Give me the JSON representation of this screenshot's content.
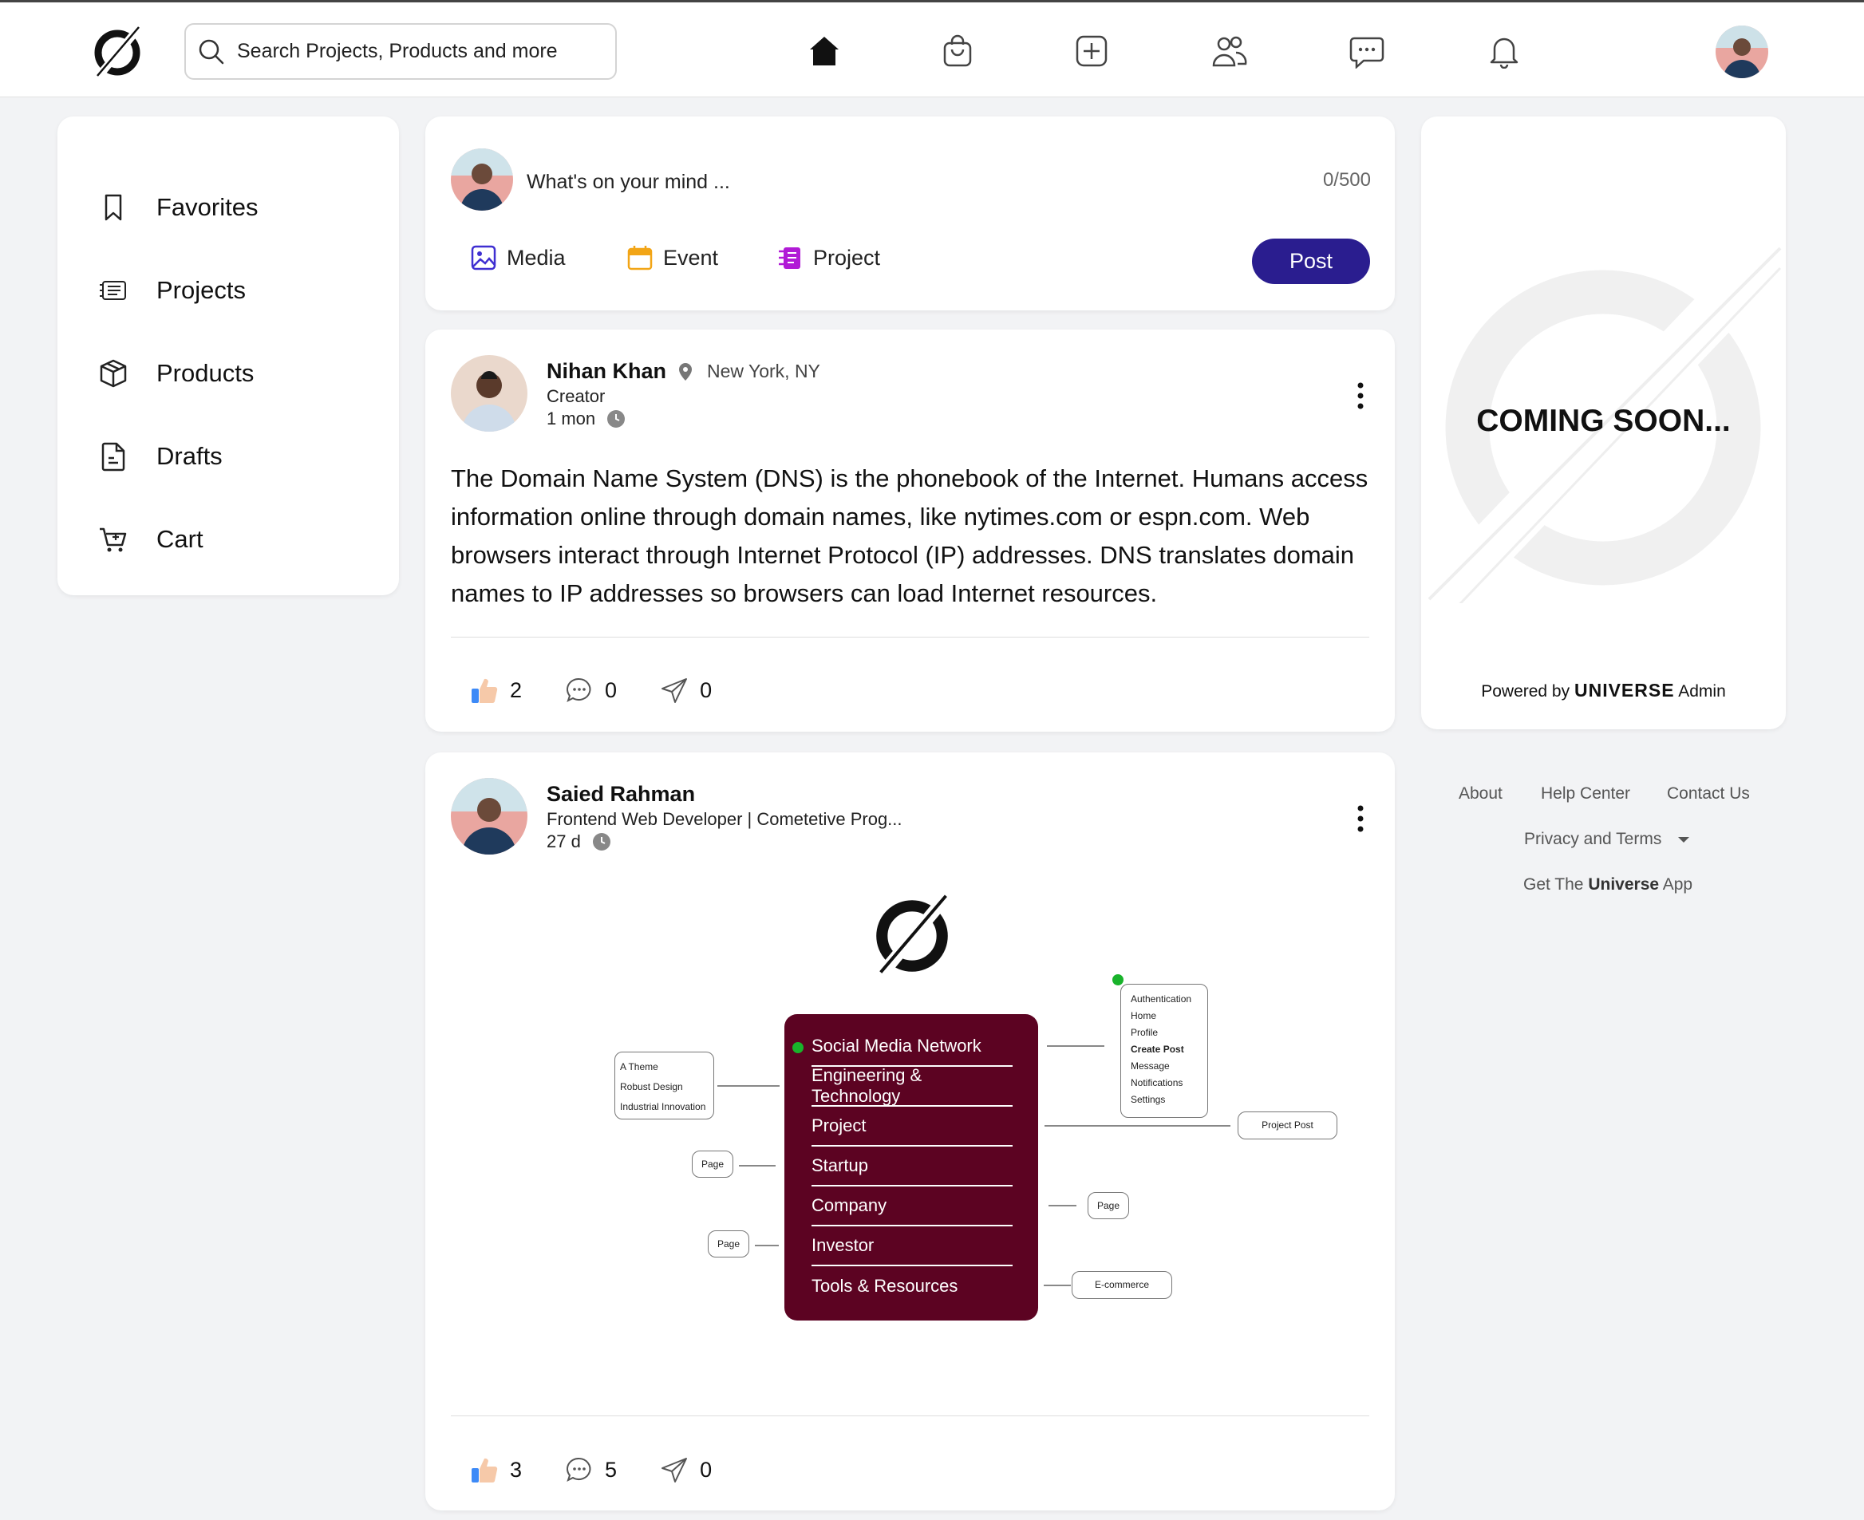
{
  "header": {
    "search_placeholder": "Search Projects, Products and more",
    "nav_icons": [
      "home-icon",
      "shopping-bag-icon",
      "plus-square-icon",
      "people-icon",
      "chat-icon",
      "bell-icon"
    ]
  },
  "sidebar": {
    "items": [
      {
        "label": "Favorites",
        "icon": "bookmark-icon"
      },
      {
        "label": "Projects",
        "icon": "projects-icon"
      },
      {
        "label": "Products",
        "icon": "box-icon"
      },
      {
        "label": "Drafts",
        "icon": "document-icon"
      },
      {
        "label": "Cart",
        "icon": "cart-icon"
      }
    ]
  },
  "composer": {
    "placeholder": "What's on your mind ...",
    "counter": "0/500",
    "actions": [
      {
        "label": "Media",
        "icon": "image-icon"
      },
      {
        "label": "Event",
        "icon": "calendar-icon"
      },
      {
        "label": "Project",
        "icon": "project-icon"
      }
    ],
    "post_label": "Post"
  },
  "posts": [
    {
      "author": "Nihan Khan",
      "location": "New York, NY",
      "role": "Creator",
      "time": "1 mon",
      "body": "The Domain Name System (DNS) is the phonebook of the Internet. Humans access information online through domain names, like nytimes.com or espn.com. Web browsers interact through Internet Protocol (IP) addresses. DNS translates domain names to IP addresses so browsers can load Internet resources.",
      "likes": "2",
      "comments": "0",
      "shares": "0"
    },
    {
      "author": "Saied Rahman",
      "role": "Frontend Web Developer | Cometetive Prog...",
      "time": "27 d",
      "diagram": {
        "menu": [
          "Social Media Network",
          "Engineering & Technology",
          "Project",
          "Startup",
          "Company",
          "Investor",
          "Tools & Resources"
        ],
        "left_box": [
          "A Theme",
          "Robust Design",
          "Industrial Innovation"
        ],
        "right_box": [
          "Authentication",
          "Home",
          "Profile",
          "Create Post",
          "Message",
          "Notifications",
          "Settings"
        ],
        "page_label": "Page",
        "project_post": "Project Post",
        "ecommerce": "E-commerce"
      },
      "likes": "3",
      "comments": "5",
      "shares": "0"
    }
  ],
  "promo": {
    "heading": "COMING SOON...",
    "powered_prefix": "Powered by",
    "brand": "UNIVERSE",
    "suffix": "Admin"
  },
  "footer": {
    "about": "About",
    "help": "Help Center",
    "contact": "Contact Us",
    "privacy": "Privacy and Terms",
    "get_prefix": "Get The",
    "get_brand": "Universe",
    "get_suffix": "App"
  },
  "colors": {
    "primary_button": "#2a1d8f",
    "diagram_menu": "#5c0322",
    "status_green": "#19b32b"
  }
}
